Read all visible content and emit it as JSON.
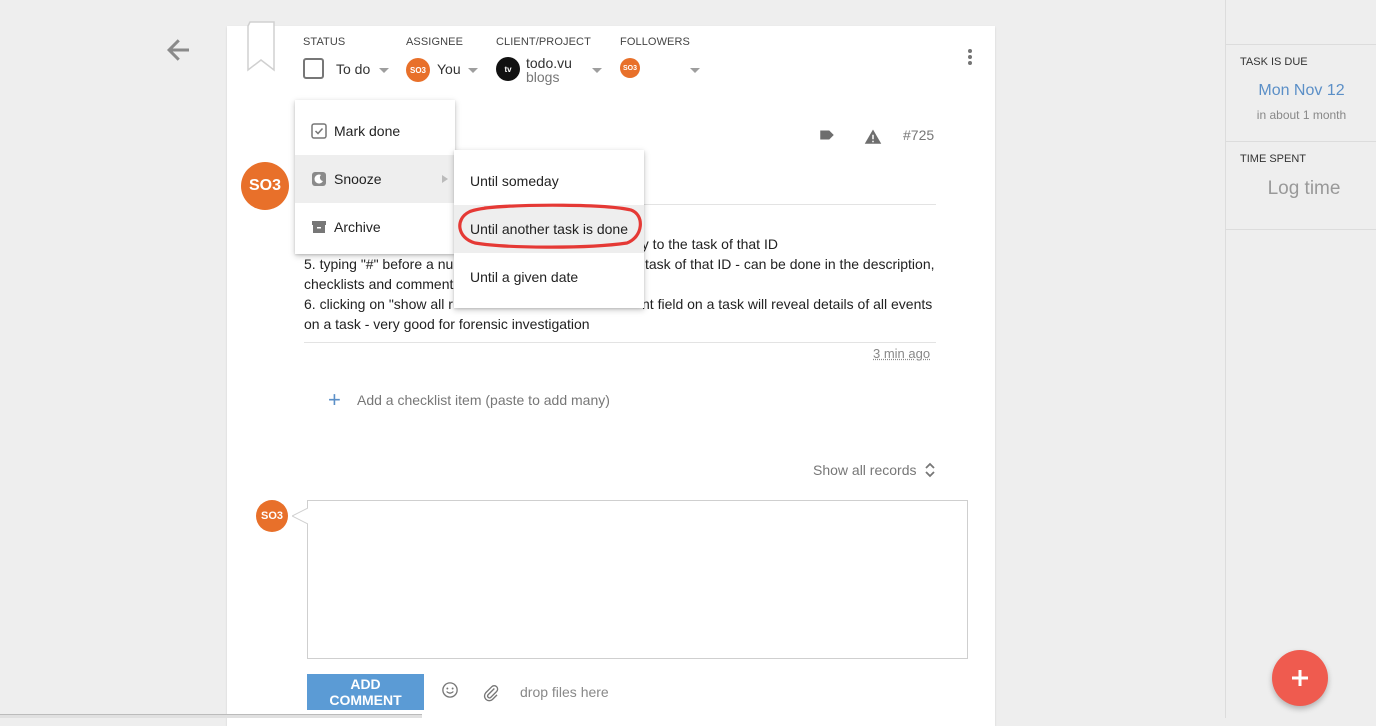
{
  "header": {
    "status": {
      "label": "STATUS",
      "value": "To do"
    },
    "assignee": {
      "label": "ASSIGNEE",
      "avatar_text": "SO3",
      "value": "You"
    },
    "client_project": {
      "label": "CLIENT/PROJECT",
      "logo_text": "tv",
      "client": "todo.vu",
      "project": "blogs"
    },
    "followers": {
      "label": "FOLLOWERS",
      "avatar_text": "SO3"
    }
  },
  "task": {
    "id": "#725",
    "author_avatar": "SO3",
    "description_lines": [
      "ectly to the task of that ID",
      "5. typing \"#\" before a nu",
      "task of that ID - can be done in the description,",
      "checklists and comment",
      "6. clicking on \"show all r",
      "nt field on a task will reveal details of all events",
      "on a task - very good for forensic investigation"
    ],
    "timestamp": "3 min ago",
    "add_checklist": "Add a checklist item (paste to add many)",
    "show_records": "Show all records"
  },
  "status_menu": {
    "items": [
      {
        "label": "Mark done",
        "icon": "check-square-icon"
      },
      {
        "label": "Snooze",
        "icon": "moon-icon"
      },
      {
        "label": "Archive",
        "icon": "archive-icon"
      }
    ]
  },
  "snooze_menu": {
    "items": [
      {
        "label": "Until someday"
      },
      {
        "label": "Until another task is done"
      },
      {
        "label": "Until a given date"
      }
    ],
    "highlight_color": "#e53935"
  },
  "comment": {
    "avatar_text": "SO3",
    "button_label": "ADD COMMENT",
    "drop_text": "drop files here"
  },
  "sidebar": {
    "due_label": "TASK IS DUE",
    "due_date": "Mon Nov 12",
    "due_relative": "in about 1 month",
    "time_label": "TIME SPENT",
    "log_time": "Log time"
  },
  "colors": {
    "avatar": "#e8702a",
    "accent_blue": "#5b9bd5",
    "fab": "#ef5b4f"
  }
}
